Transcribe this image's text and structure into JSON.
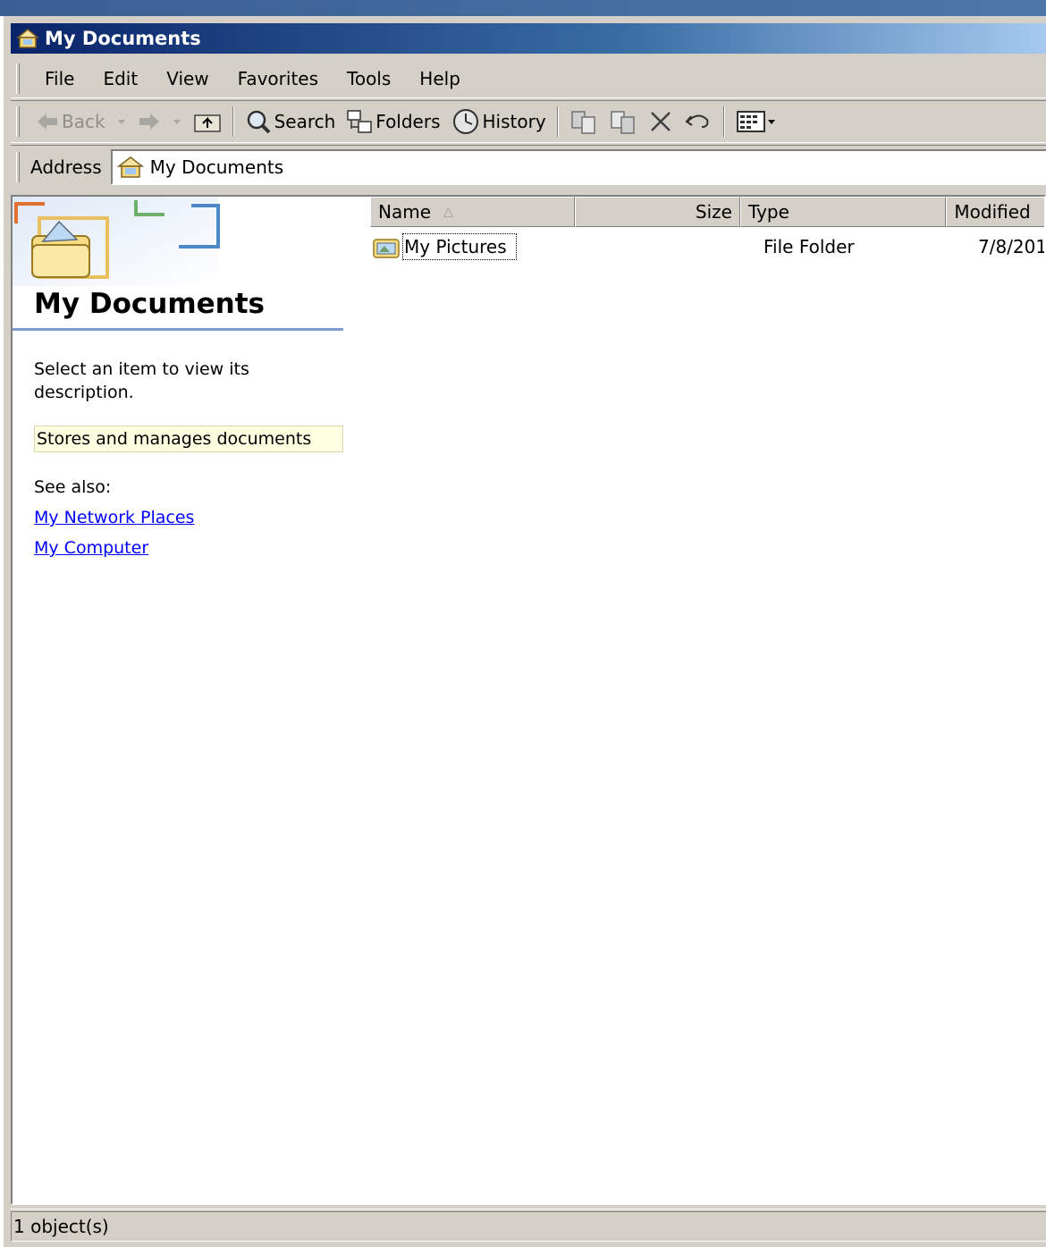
{
  "window": {
    "title": "My Documents"
  },
  "menu": {
    "items": [
      "File",
      "Edit",
      "View",
      "Favorites",
      "Tools",
      "Help"
    ]
  },
  "toolbar": {
    "back_label": "Back",
    "search_label": "Search",
    "folders_label": "Folders",
    "history_label": "History"
  },
  "address": {
    "label": "Address",
    "value": "My Documents"
  },
  "left_pane": {
    "title": "My Documents",
    "description": "Select an item to view its description.",
    "info": "Stores and manages documents",
    "see_also": "See also:",
    "links": [
      "My Network Places",
      "My Computer"
    ]
  },
  "list": {
    "columns": {
      "name": "Name",
      "size": "Size",
      "type": "Type",
      "modified": "Modified"
    },
    "rows": [
      {
        "name": "My Pictures",
        "size": "",
        "type": "File Folder",
        "modified": "7/8/201"
      }
    ]
  },
  "status": {
    "text": "1 object(s)"
  },
  "colors": {
    "titlebar_start": "#0a246a",
    "face": "#d4d0c8",
    "link": "#0000ff",
    "info_bg": "#ffffe1"
  }
}
